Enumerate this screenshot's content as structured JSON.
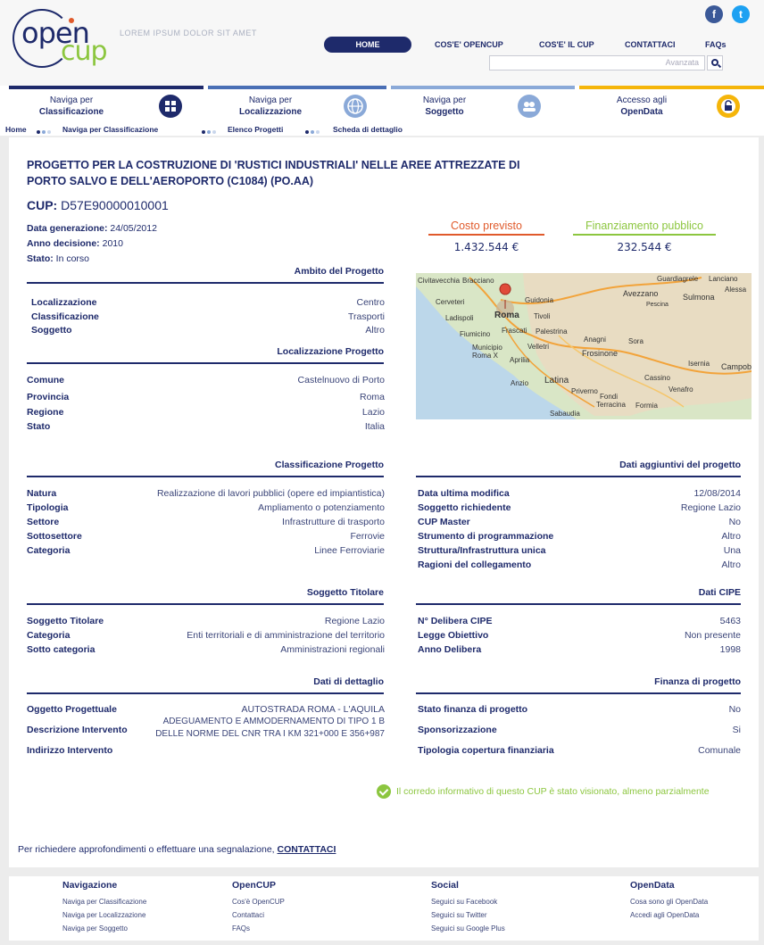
{
  "header": {
    "logo_open": "open",
    "logo_cup": "cup",
    "tagline": "LOREM IPSUM DOLOR SIT AMET",
    "social": {
      "facebook": "f",
      "twitter": "t"
    },
    "nav": [
      "HOME",
      "COS'E' OPENCUP",
      "COS'E' IL CUP",
      "CONTATTACI",
      "FAQs"
    ],
    "search_placeholder": "Avanzata"
  },
  "categories": [
    {
      "line1": "Naviga per",
      "line2": "Classificazione",
      "color": "#1e2a6b",
      "icon": "grid-icon"
    },
    {
      "line1": "Naviga per",
      "line2": "Localizzazione",
      "color": "#4a6fb5",
      "icon": "globe-icon"
    },
    {
      "line1": "Naviga per",
      "line2": "Soggetto",
      "color": "#8aa9d8",
      "icon": "people-icon"
    },
    {
      "line1": "Accesso agli",
      "line2": "OpenData",
      "color": "#f5b50a",
      "icon": "lock-icon"
    }
  ],
  "breadcrumb": [
    "Home",
    "Naviga per Classificazione",
    "Elenco Progetti",
    "Scheda di dettaglio"
  ],
  "project": {
    "title": "PROGETTO PER LA COSTRUZIONE DI 'RUSTICI INDUSTRIALI' NELLE AREE ATTREZZATE DI PORTO SALVO E DELL'AEROPORTO (C1084) (PO.AA)",
    "cup_label": "CUP:",
    "cup_value": "D57E90000010001",
    "data_generazione_label": "Data generazione:",
    "data_generazione": "24/05/2012",
    "anno_decisione_label": "Anno decisione:",
    "anno_decisione": "2010",
    "stato_label": "Stato:",
    "stato": "In corso",
    "costo_label": "Costo previsto",
    "costo_value": "1.432.544 €",
    "finanziamento_label": "Finanziamento pubblico",
    "finanziamento_value": "232.544 €"
  },
  "ambito": {
    "title": "Ambito del Progetto",
    "rows": [
      [
        "Localizzazione",
        "Centro"
      ],
      [
        "Classificazione",
        "Trasporti"
      ],
      [
        "Soggetto",
        "Altro"
      ]
    ]
  },
  "localizzazione": {
    "title": "Localizzazione Progetto",
    "rows": [
      [
        "Comune",
        "Castelnuovo di Porto"
      ],
      [
        "Provincia",
        "Roma"
      ],
      [
        "Regione",
        "Lazio"
      ],
      [
        "Stato",
        "Italia"
      ]
    ]
  },
  "classificazione": {
    "title": "Classificazione Progetto",
    "rows": [
      [
        "Natura",
        "Realizzazione di lavori pubblici (opere ed impiantistica)"
      ],
      [
        "Tipologia",
        "Ampliamento o potenziamento"
      ],
      [
        "Settore",
        "Infrastrutture di trasporto"
      ],
      [
        "Sottosettore",
        "Ferrovie"
      ],
      [
        "Categoria",
        "Linee Ferroviarie"
      ]
    ]
  },
  "aggiuntivi": {
    "title": "Dati aggiuntivi del progetto",
    "rows": [
      [
        "Data ultima modifica",
        "12/08/2014"
      ],
      [
        "Soggetto richiedente",
        "Regione Lazio"
      ],
      [
        "CUP Master",
        "No"
      ],
      [
        "Strumento di programmazione",
        "Altro"
      ],
      [
        "Struttura/Infrastruttura unica",
        "Una"
      ],
      [
        "Ragioni del collegamento",
        "Altro"
      ]
    ]
  },
  "titolare": {
    "title": "Soggetto Titolare",
    "rows": [
      [
        "Soggetto Titolare",
        "Regione Lazio"
      ],
      [
        "Categoria",
        "Enti territoriali e di amministrazione del territorio"
      ],
      [
        "Sotto categoria",
        "Amministrazioni regionali"
      ]
    ]
  },
  "cipe": {
    "title": "Dati CIPE",
    "rows": [
      [
        "N° Delibera CIPE",
        "5463"
      ],
      [
        "Legge Obiettivo",
        "Non presente"
      ],
      [
        "Anno Delibera",
        "1998"
      ]
    ]
  },
  "dettaglio": {
    "title": "Dati di dettaglio",
    "oggetto_label": "Oggetto Progettuale",
    "oggetto": "AUTOSTRADA ROMA - L'AQUILA",
    "descrizione_label": "Descrizione Intervento",
    "descrizione_1": "ADEGUAMENTO E AMMODERNAMENTO DI TIPO 1 B",
    "descrizione_2": "DELLE NORME DEL CNR TRA I KM 321+000 E 356+987",
    "indirizzo_label": "Indirizzo Intervento"
  },
  "finanza": {
    "title": "Finanza di progetto",
    "rows": [
      [
        "Stato finanza di progetto",
        "No"
      ],
      [
        "Sponsorizzazione",
        "Si"
      ],
      [
        "Tipologia copertura finanziaria",
        "Comunale"
      ]
    ]
  },
  "map_labels": [
    "Civitavecchia",
    "Bracciano",
    "Cerveteri",
    "Guidonia",
    "Ladispoli",
    "Roma",
    "Tivoli",
    "Fiumicino",
    "Frascati",
    "Palestrina",
    "Municipio Roma X",
    "Velletri",
    "Aprilia",
    "Anzio",
    "Latina",
    "Frosinone",
    "Avezzano",
    "Sulmona",
    "Pescina",
    "Sora",
    "Cassino",
    "Formia",
    "Sabaudia",
    "Terracina",
    "Fondi",
    "Priverno",
    "Isernia",
    "Venafro",
    "Campobasso",
    "Anagni",
    "Guardiagrele",
    "Lanciano",
    "Alessa"
  ],
  "visionato": "Il corredo informativo di questo CUP è stato visionato, almeno parzialmente",
  "contact": {
    "text": "Per richiedere approfondimenti o effettuare una segnalazione,",
    "link": "CONTATTACI"
  },
  "footer": [
    {
      "title": "Navigazione",
      "links": [
        "Naviga per Classificazione",
        "Naviga per Localizzazione",
        "Naviga per Soggetto"
      ]
    },
    {
      "title": "OpenCUP",
      "links": [
        "Cos'è OpenCUP",
        "Contattaci",
        "FAQs"
      ]
    },
    {
      "title": "Social",
      "links": [
        "Seguici su Facebook",
        "Seguici su Twitter",
        "Seguici su Google Plus"
      ]
    },
    {
      "title": "OpenData",
      "links": [
        "Cosa sono gli OpenData",
        "Accedi agli OpenData"
      ]
    }
  ]
}
